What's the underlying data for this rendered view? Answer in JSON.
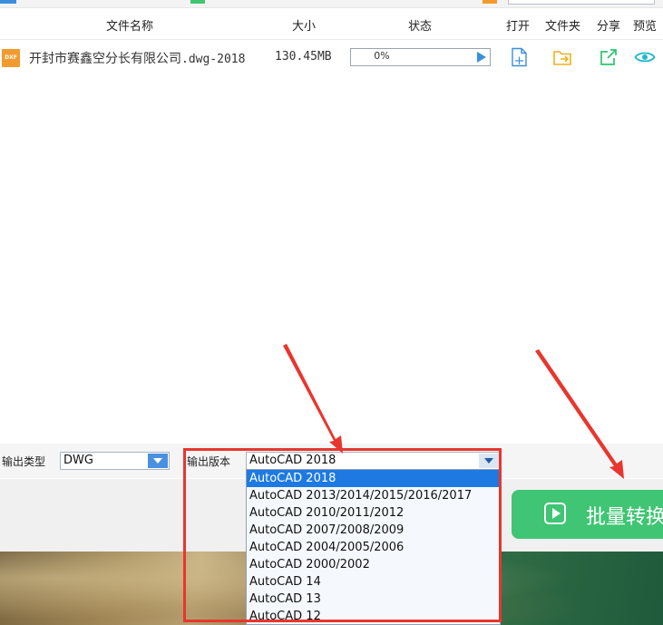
{
  "colors": {
    "accent_blue": "#1e7ae2",
    "batch_green": "#3fc573",
    "annotation_red": "#e8362e",
    "file_icon_orange": "#f29a2e"
  },
  "header": {
    "col_name": "文件名称",
    "col_size": "大小",
    "col_status": "状态",
    "col_open": "打开",
    "col_folder": "文件夹",
    "col_share": "分享",
    "col_preview": "预览"
  },
  "file": {
    "icon_label": "DXF",
    "name_prefix": "开封市赛鑫空分长有限公司",
    "name_ext": ".dwg-2018",
    "size": "130.45MB",
    "progress_text": "0%",
    "progress_value": 0,
    "icons": [
      "open-file-icon",
      "folder-icon",
      "share-icon",
      "preview-eye-icon"
    ]
  },
  "options": {
    "output_type_label": "输出类型",
    "output_type_value": "DWG",
    "output_version_label": "输出版本",
    "output_version_value": "AutoCAD 2018",
    "version_options": [
      "AutoCAD 2018",
      "AutoCAD 2013/2014/2015/2016/2017",
      "AutoCAD 2010/2011/2012",
      "AutoCAD 2007/2008/2009",
      "AutoCAD 2004/2005/2006",
      "AutoCAD 2000/2002",
      "AutoCAD 14",
      "AutoCAD 13",
      "AutoCAD 12"
    ],
    "selected_index": 0
  },
  "batch_button": {
    "label": "批量转换"
  }
}
